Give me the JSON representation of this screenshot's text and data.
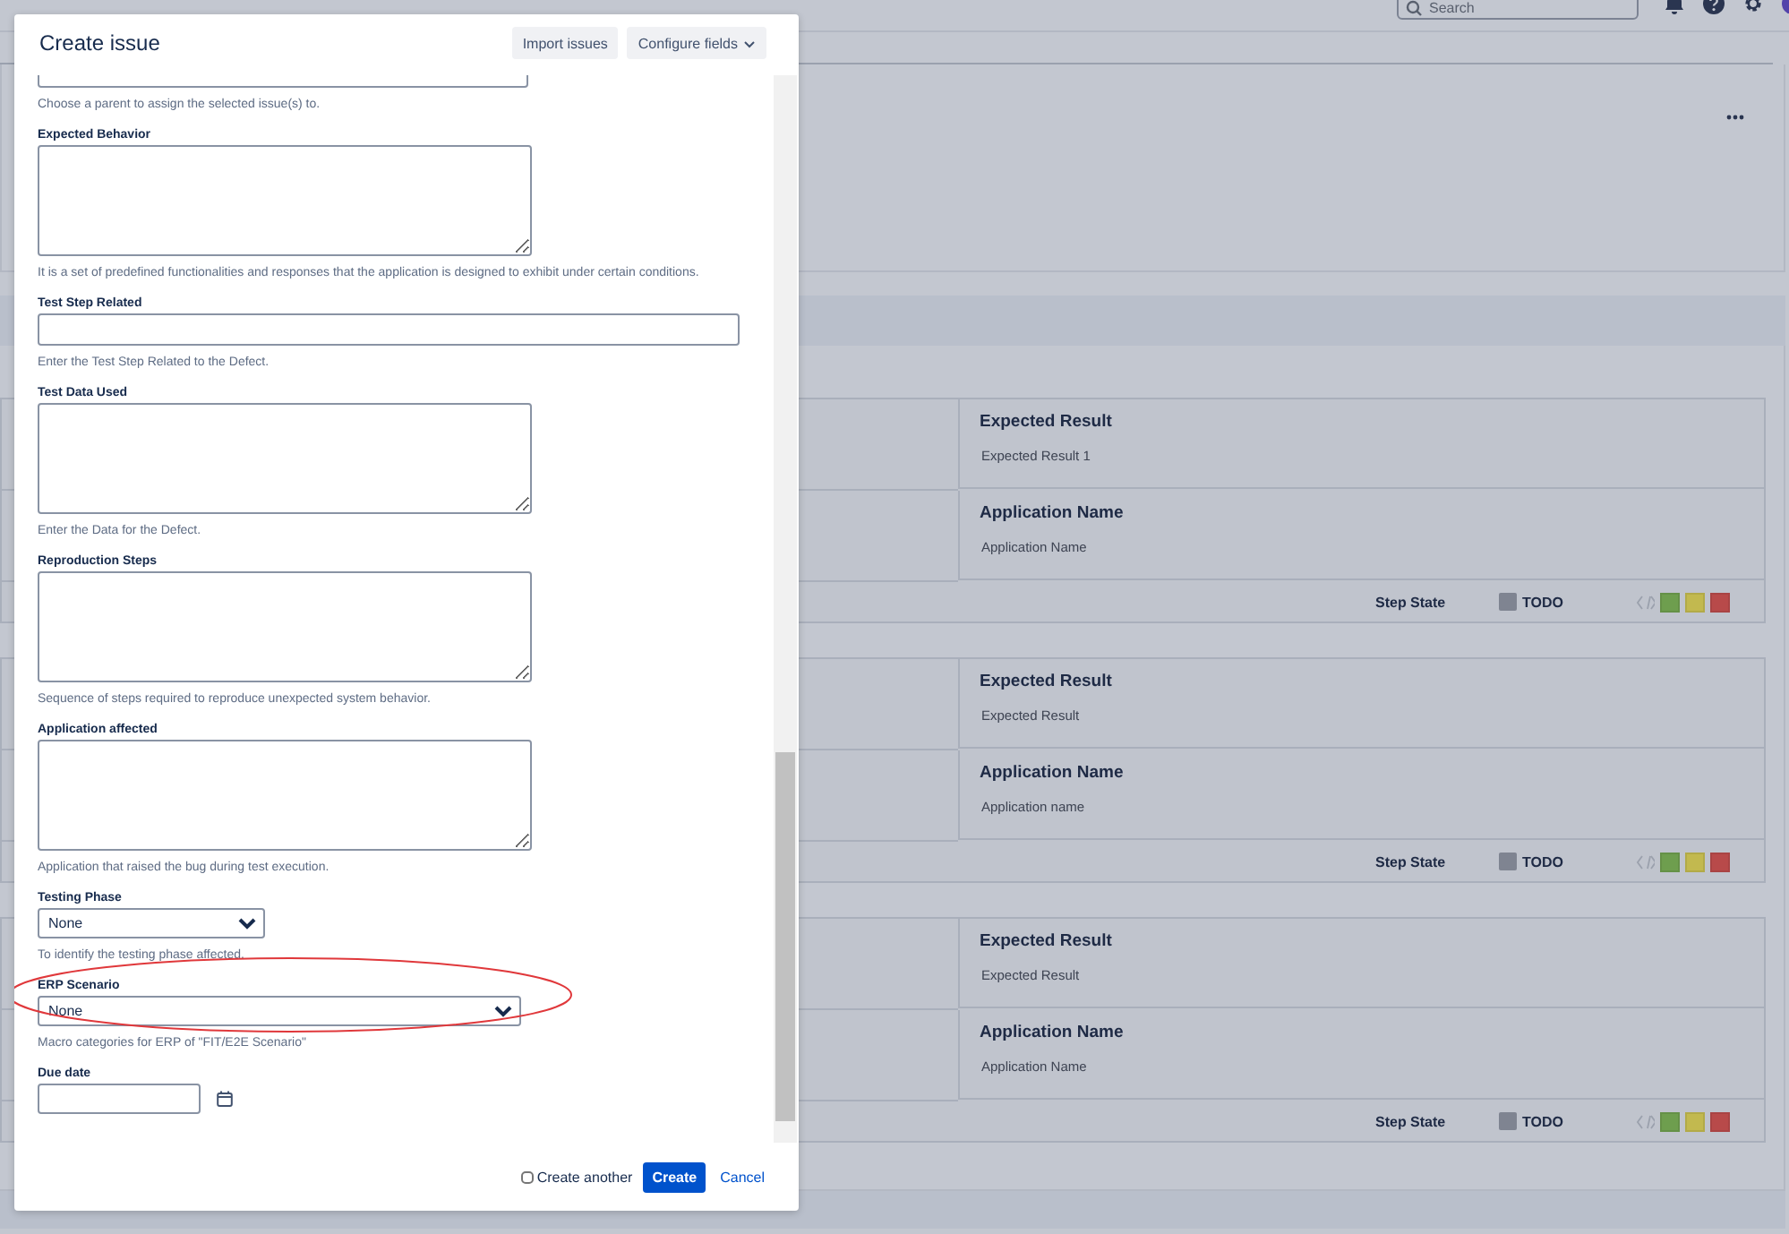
{
  "background": {
    "search": {
      "placeholder": "Search"
    },
    "steps": [
      {
        "expected_heading": "Expected Result",
        "expected": "Expected Result 1",
        "app_heading": "Application Name",
        "app": "Application Name",
        "state_label": "Step State",
        "state": "TODO",
        "color": "#7f8491"
      },
      {
        "expected_heading": "Expected Result",
        "expected": "Expected Result",
        "app_heading": "Application Name",
        "app": "Application name",
        "state_label": "Step State",
        "state": "TODO",
        "color": "#7f8491"
      },
      {
        "expected_heading": "Expected Result",
        "expected": "Expected Result",
        "app_heading": "Application Name",
        "app": "Application Name",
        "state_label": "Step State",
        "state": "TODO",
        "color": "#7f8491"
      }
    ]
  },
  "dialog": {
    "title": "Create issue",
    "header_buttons": [
      {
        "label": "Import issues",
        "dropdown": false
      },
      {
        "label": "Configure fields",
        "dropdown": true
      }
    ],
    "fields": [
      {
        "kind": "parent",
        "description": "Choose a parent to assign the selected issue(s) to."
      },
      {
        "kind": "textarea",
        "label": "Expected Behavior",
        "description": "It is a set of predefined functionalities and responses that the application is designed to exhibit under certain conditions."
      },
      {
        "kind": "text",
        "label": "Test Step Related",
        "description": "Enter the Test Step Related to the Defect."
      },
      {
        "kind": "textarea",
        "label": "Test Data Used",
        "description": "Enter the Data for the Defect."
      },
      {
        "kind": "textarea",
        "label": "Reproduction Steps",
        "description": "Sequence of steps required to reproduce unexpected system behavior."
      },
      {
        "kind": "textarea",
        "label": "Application affected",
        "description": "Application that raised the bug during test execution."
      },
      {
        "kind": "select",
        "label": "Testing Phase",
        "value": "None",
        "description": "To identify the testing phase affected."
      },
      {
        "kind": "wide-select",
        "label": "ERP Scenario",
        "value": "None",
        "description": "Macro categories for ERP of \"FIT/E2E Scenario\"",
        "highlighted": true
      },
      {
        "kind": "date",
        "label": "Due date"
      }
    ],
    "footer": {
      "create_another": {
        "label": "Create another",
        "checked": false
      },
      "submit": "Create",
      "cancel": "Cancel"
    }
  }
}
